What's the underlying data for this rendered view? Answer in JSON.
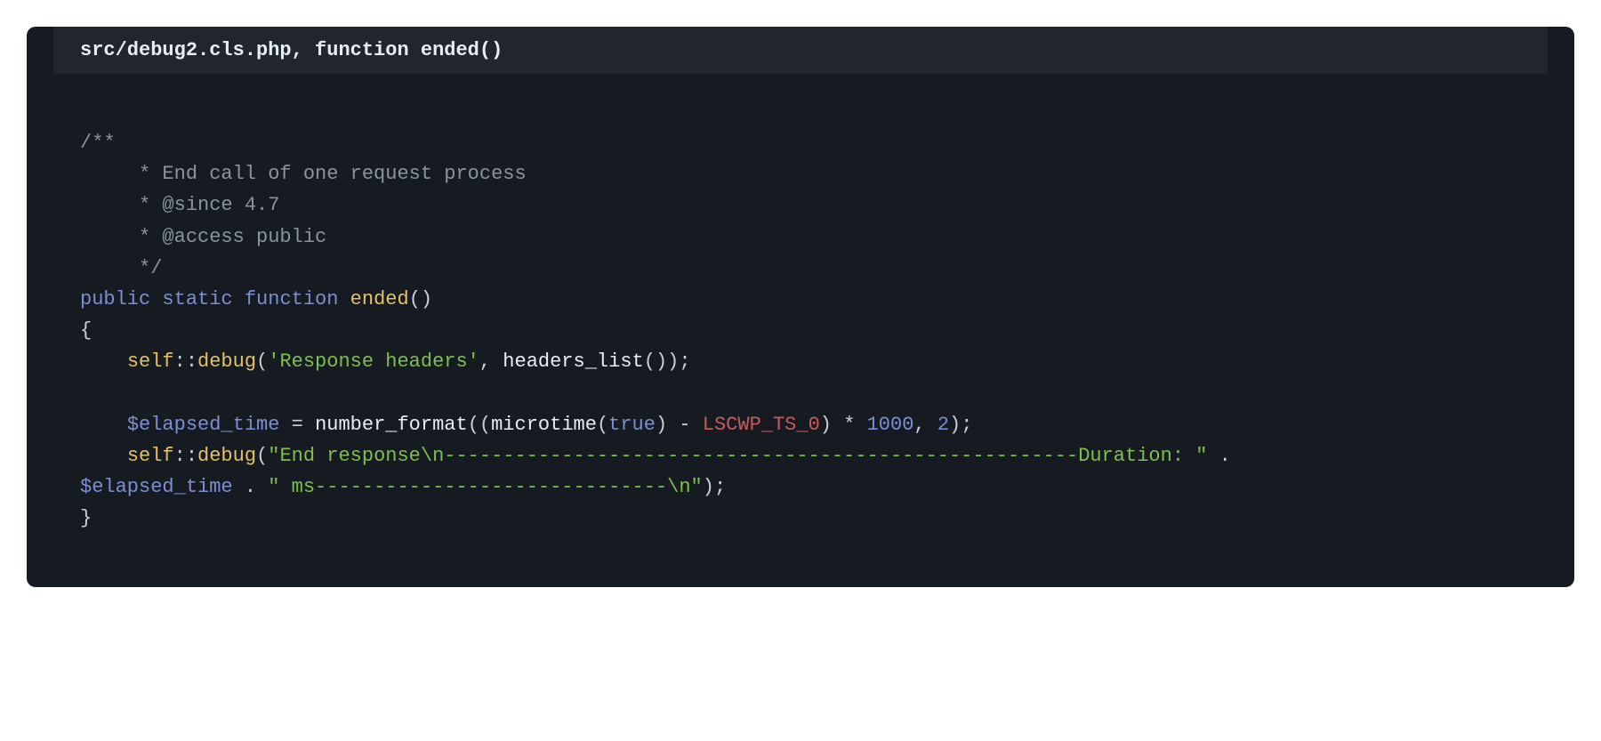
{
  "header": "src/debug2.cls.php, function ended()",
  "code": {
    "comment_open": "/**",
    "comment_l1": "     * End call of one request process",
    "comment_l2": "     * @since 4.7",
    "comment_l3": "     * @access public",
    "comment_close": "     */",
    "kw_public": "public",
    "kw_static": "static",
    "kw_function": "function",
    "fn_name": "ended",
    "paren_open": "(",
    "paren_close": ")",
    "brace_open": "{",
    "brace_close": "}",
    "indent1": "    ",
    "self": "self",
    "dcolon": "::",
    "method_debug": "debug",
    "str_resp_headers": "'Response headers'",
    "comma_sp": ", ",
    "fn_headers_list": "headers_list",
    "semi": ";",
    "var_elapsed": "$elapsed_time",
    "eq": " = ",
    "fn_number_format": "number_format",
    "fn_microtime": "microtime",
    "bool_true": "true",
    "op_minus": " - ",
    "const_lscwp": "LSCWP_TS_0",
    "op_mul": " * ",
    "num_1000": "1000",
    "num_2": "2",
    "str_end1": "\"End response\\n------------------------------------------------------Duration: \"",
    "op_concat": " . ",
    "str_end2": "\" ms------------------------------\\n\"",
    "indent0": ""
  }
}
